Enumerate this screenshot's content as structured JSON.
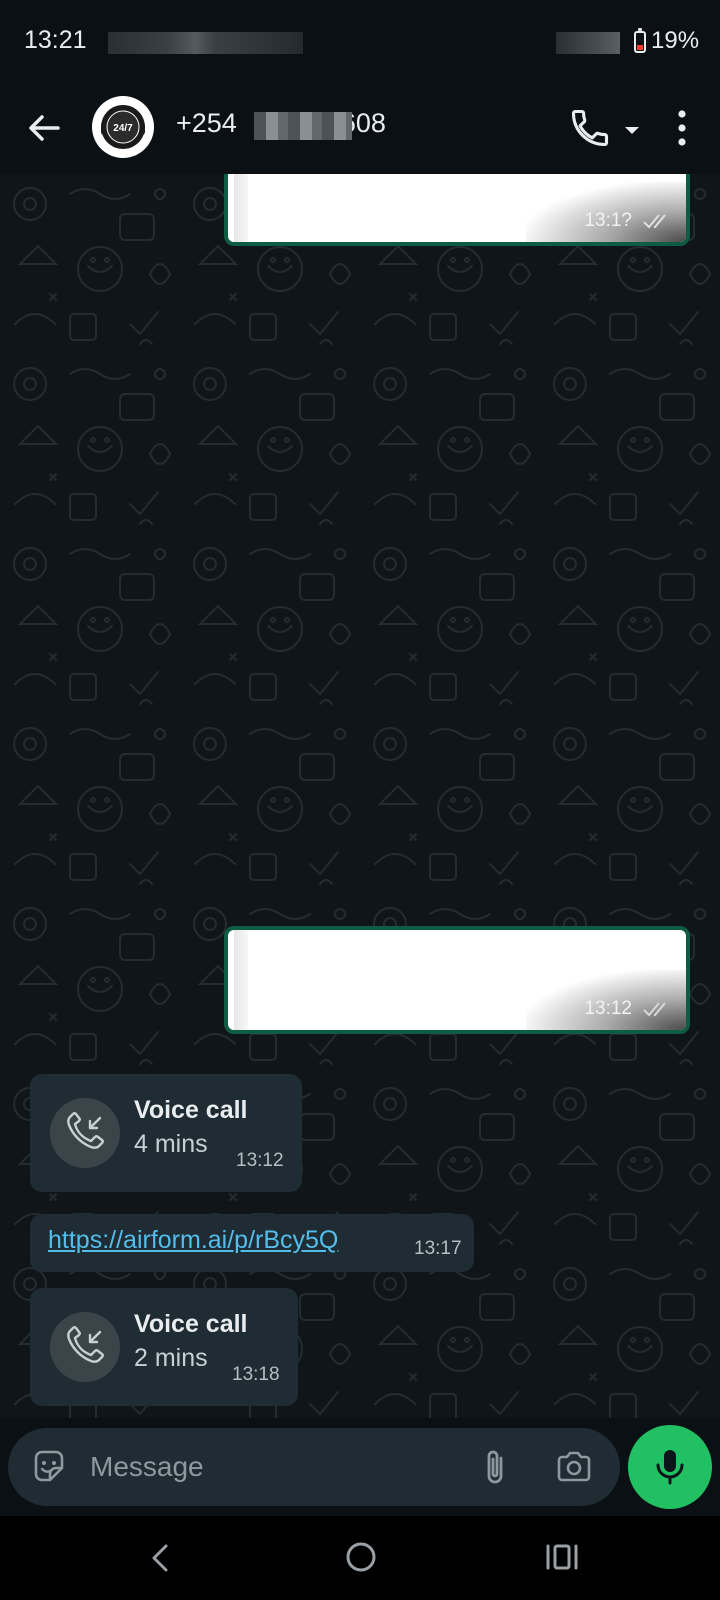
{
  "status_bar": {
    "time": "13:21",
    "battery": "19%"
  },
  "header": {
    "contact_prefix": "+254",
    "contact_suffix": "608",
    "avatar_text": "24/7"
  },
  "messages": {
    "outgoing_1": {
      "time": "13:1?"
    },
    "outgoing_2": {
      "time": "13:12"
    },
    "call_1": {
      "title": "Voice call",
      "duration": "4 mins",
      "time": "13:12"
    },
    "link_1": {
      "text": "https://airform.ai/p/rBcy5Q",
      "time": "13:17"
    },
    "call_2": {
      "title": "Voice call",
      "duration": "2 mins",
      "time": "13:18"
    }
  },
  "composer": {
    "placeholder": "Message"
  },
  "colors": {
    "accent_green": "#21c063",
    "bubble_incoming": "#1f2c33",
    "bubble_outgoing_border": "#0d5c43",
    "link": "#53bdeb",
    "tick": "#8696a0"
  },
  "icons": {
    "back": "arrow-left-icon",
    "call": "phone-icon",
    "dropdown": "caret-down-icon",
    "menu": "more-vertical-icon",
    "incoming_call": "incoming-call-icon",
    "sticker": "sticker-icon",
    "attach": "paperclip-icon",
    "camera": "camera-icon",
    "mic": "microphone-icon"
  }
}
